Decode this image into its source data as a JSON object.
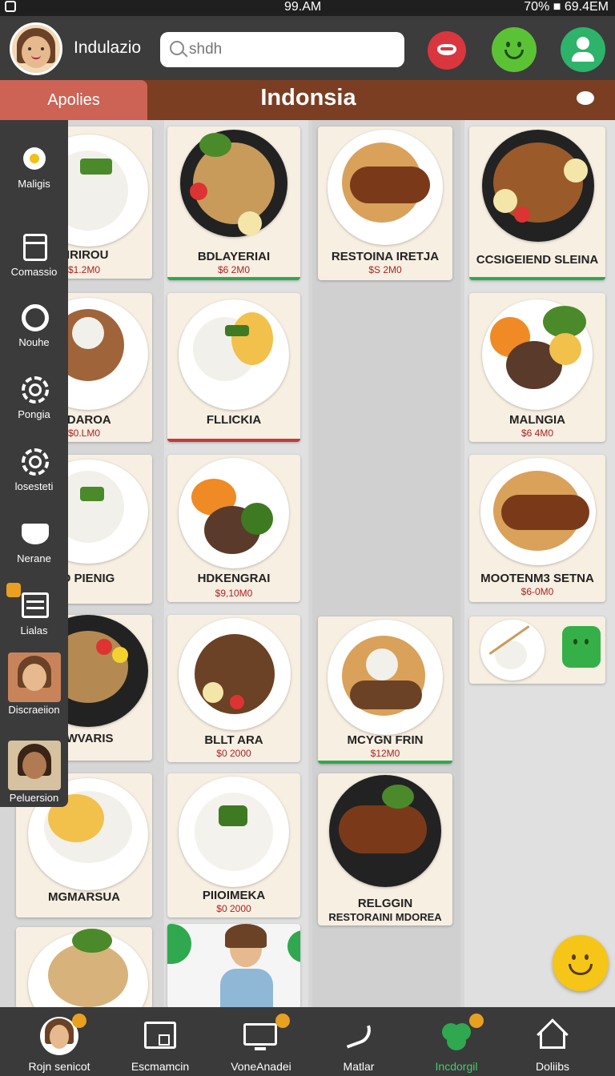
{
  "status": {
    "time": "99.AM",
    "right": "70% ■ 69.4EM"
  },
  "header": {
    "username": "Indulazio",
    "search_placeholder": "shdh"
  },
  "tabs": {
    "left": "Apolies",
    "title": "Indonsia"
  },
  "sidebar": {
    "items": [
      {
        "label": "Maligis",
        "icon": "flower-icon"
      },
      {
        "label": "Comassio",
        "icon": "document-icon"
      },
      {
        "label": "Nouhe",
        "icon": "ring-icon"
      },
      {
        "label": "Pongia",
        "icon": "gear-icon"
      },
      {
        "label": "losesteti",
        "icon": "gear-icon"
      },
      {
        "label": "Nerane",
        "icon": "shield-icon"
      },
      {
        "label": "Lialas",
        "icon": "list-icon"
      },
      {
        "label": "Discraeiion",
        "icon": "avatar-icon"
      },
      {
        "label": "Peluersion",
        "icon": "avatar-icon"
      }
    ]
  },
  "cards": {
    "c1": {
      "name": "MRIROU",
      "price": "$1.2M0"
    },
    "c2": {
      "name": "BDLAYERIAI",
      "price": "$6 2M0"
    },
    "c3": {
      "name": "RESTOINA IRETJA",
      "price": "$S 2M0"
    },
    "c4": {
      "name": "CCSIGEIEND SLEINA",
      "price": ""
    },
    "c5": {
      "name": "MDAROA",
      "price": "$0.LM0"
    },
    "c6": {
      "name": "FLLICKIA",
      "price": ""
    },
    "c7": {
      "name": "MALNGIA",
      "price": "$6 4M0"
    },
    "c8": {
      "name": "ND PIENIG",
      "price": ""
    },
    "c9": {
      "name": "HDKENGRAI",
      "price": "$9,10M0"
    },
    "c10": {
      "name": "MOOTENM3 SETNA",
      "price": "$6-0M0"
    },
    "c11": {
      "name": "VIWVARIS",
      "price": ""
    },
    "c12": {
      "name": "BLLT ARA",
      "price": "$0 2000"
    },
    "c13": {
      "name": "MCYGN FRIN",
      "price": "$12M0"
    },
    "c14": {
      "name": "MGMARSUA",
      "price": ""
    },
    "c15": {
      "name": "PIIOIMEKA",
      "price": "$0 2000"
    },
    "c16": {
      "name": "RELGGIN",
      "price": "RESTORAINI MDOREA"
    }
  },
  "bottom_nav": {
    "items": [
      {
        "label": "Rojn senicot",
        "icon": "profile-icon"
      },
      {
        "label": "Escmamcin",
        "icon": "folder-icon"
      },
      {
        "label": "VoneAnadei",
        "icon": "monitor-icon"
      },
      {
        "label": "Matlar",
        "icon": "swoosh-icon"
      },
      {
        "label": "Incdorgil",
        "icon": "clover-icon"
      },
      {
        "label": "Doliibs",
        "icon": "home-icon"
      }
    ]
  },
  "colors": {
    "accent_green": "#2fa84f",
    "accent_red": "#c43a3a",
    "header": "#3c3c3c",
    "tabbar": "#7b3e22"
  }
}
